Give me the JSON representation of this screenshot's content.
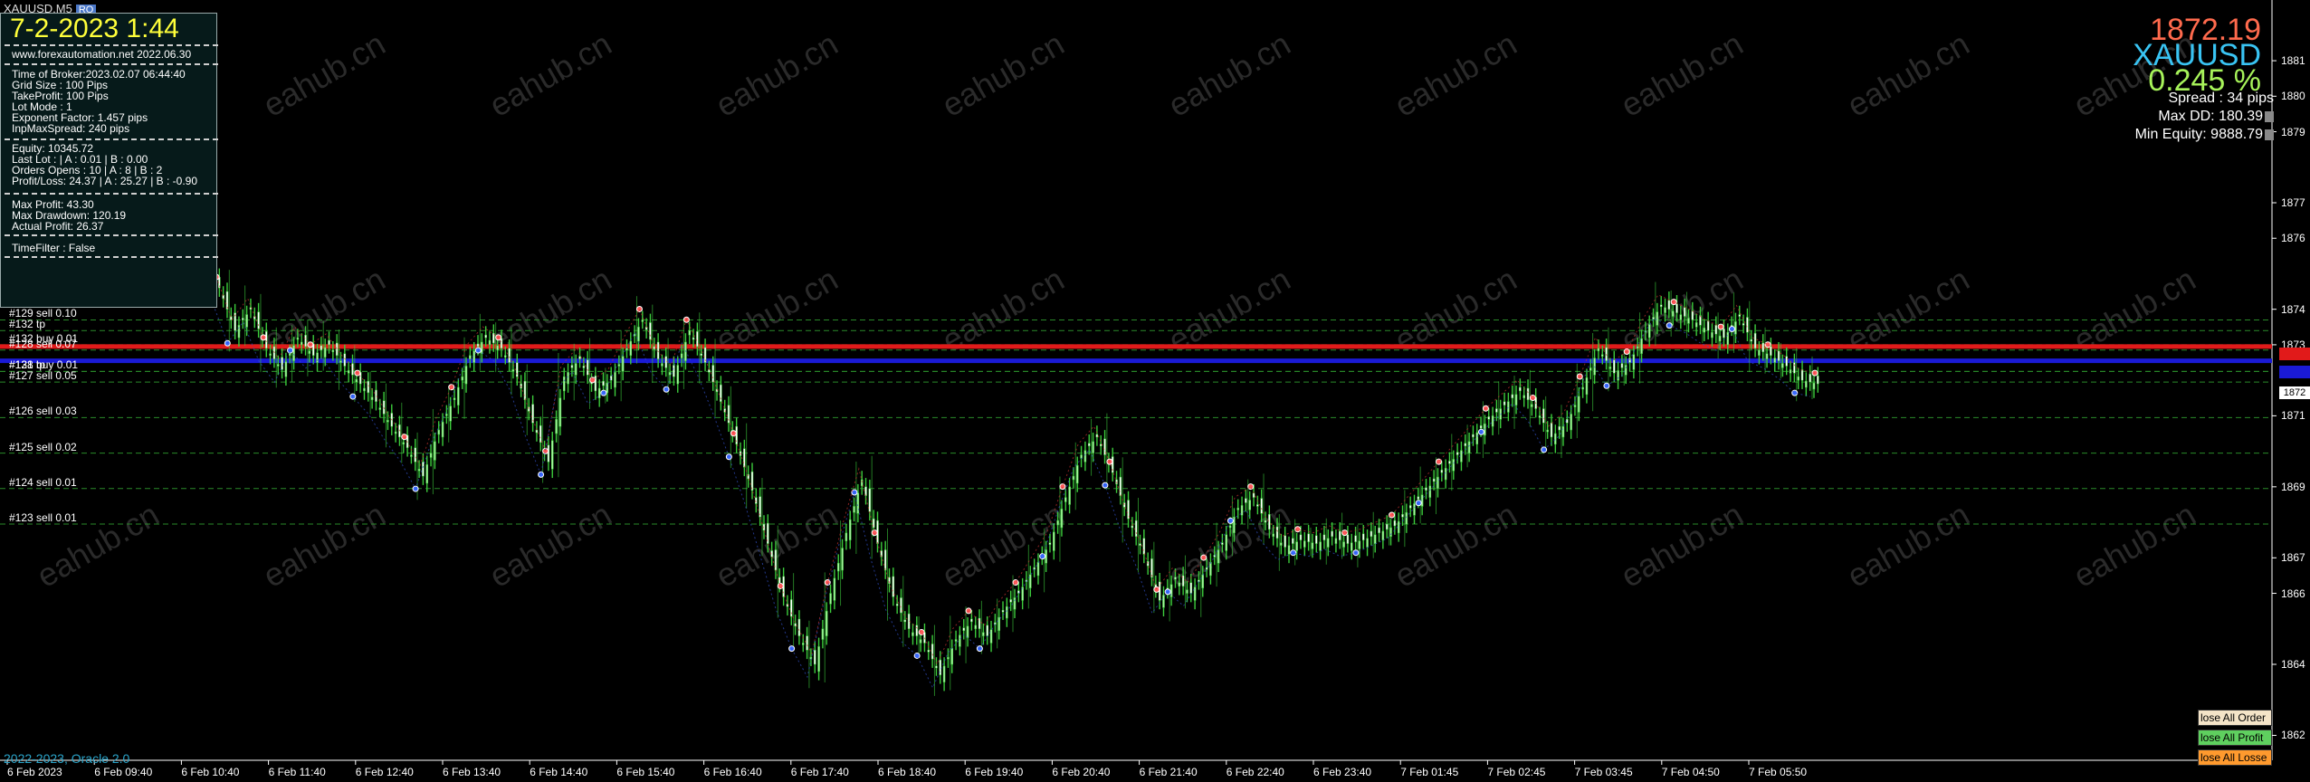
{
  "window": {
    "symbol_tf": "XAUUSD,M5",
    "badge": "RO"
  },
  "panel": {
    "datetime": "7-2-2023 1:44",
    "site": "www.forexautomation.net 2022.06.30",
    "block1": [
      "Time of Broker:2023.02.07 06:44:40",
      "Grid Size : 100 Pips",
      "TakeProfit: 100 Pips",
      "Lot Mode : 1",
      "Exponent Factor: 1.457 pips",
      "InpMaxSpread: 240 pips"
    ],
    "block2": [
      "Equity:      10345.72",
      "Last Lot : | A : 0.01 | B : 0.00",
      "Orders Opens :   10  | A : 8 | B : 2",
      "Profit/Loss: 24.37 | A : 25.27 | B : -0.90"
    ],
    "block3": [
      "Max Profit: 43.30",
      "Max Drawdown: 120.19",
      "Actual Profit: 26.37"
    ],
    "block4": [
      "TimeFilter : False"
    ]
  },
  "stats": {
    "price": "1872.19",
    "symbol": "XAUUSD",
    "percent": "0.245 %",
    "spread": "Spread : 34 pips",
    "max_dd": "Max DD: 180.39",
    "min_equity": "Min Equity: 9888.79"
  },
  "levels": [
    {
      "label": "#129 sell 0.10",
      "price": 1873.9
    },
    {
      "label": "#132 tp",
      "price": 1873.6
    },
    {
      "label": "#132 buy 0.01",
      "price": 1873.2
    },
    {
      "label": "#128 sell 0.07",
      "price": 1873.05
    },
    {
      "label": "#128 tp",
      "price": 1872.45
    },
    {
      "label": "#131 buy 0.01",
      "price": 1872.45
    },
    {
      "label": "#127 sell 0.05",
      "price": 1872.15
    },
    {
      "label": "#126 sell 0.03",
      "price": 1871.15
    },
    {
      "label": "#125 sell 0.02",
      "price": 1870.15
    },
    {
      "label": "#124 sell 0.01",
      "price": 1869.15
    },
    {
      "label": "#123 sell 0.01",
      "price": 1868.15
    }
  ],
  "axis": {
    "ymin": 1861.6,
    "ymax": 1882.4,
    "yticks": [
      "1881",
      "1880",
      "1879",
      "1877",
      "1876",
      "1874",
      "1873",
      "1871",
      "1869",
      "1867",
      "1866",
      "1864",
      "1862"
    ],
    "current_tag": "1872",
    "xticks": [
      "6 Feb 2023",
      "6 Feb 09:40",
      "6 Feb 10:40",
      "6 Feb 11:40",
      "6 Feb 12:40",
      "6 Feb 13:40",
      "6 Feb 14:40",
      "6 Feb 15:40",
      "6 Feb 16:40",
      "6 Feb 17:40",
      "6 Feb 18:40",
      "6 Feb 19:40",
      "6 Feb 20:40",
      "6 Feb 21:40",
      "6 Feb 22:40",
      "6 Feb 23:40",
      "7 Feb 01:45",
      "7 Feb 02:45",
      "7 Feb 03:45",
      "7 Feb 04:50",
      "7 Feb 05:50"
    ]
  },
  "series_close": [
    1874.8,
    1873.6,
    1874.2,
    1873.1,
    1872.5,
    1873.4,
    1872.9,
    1873.2,
    1872.6,
    1872.1,
    1871.6,
    1870.9,
    1870.3,
    1869.5,
    1870.8,
    1871.7,
    1872.9,
    1873.4,
    1873.1,
    1872.3,
    1871.0,
    1869.9,
    1872.3,
    1872.8,
    1871.9,
    1872.2,
    1873.1,
    1873.9,
    1872.8,
    1872.3,
    1873.6,
    1872.7,
    1871.6,
    1870.4,
    1869.1,
    1867.6,
    1866.1,
    1865.0,
    1864.2,
    1866.2,
    1867.9,
    1869.4,
    1867.6,
    1866.1,
    1865.2,
    1864.8,
    1863.9,
    1864.9,
    1865.4,
    1865.0,
    1865.7,
    1866.2,
    1866.9,
    1867.6,
    1868.9,
    1870.1,
    1870.6,
    1869.6,
    1868.3,
    1867.3,
    1866.0,
    1866.6,
    1866.2,
    1866.9,
    1867.6,
    1868.6,
    1868.9,
    1868.0,
    1867.5,
    1867.7,
    1867.6,
    1867.8,
    1867.6,
    1867.7,
    1867.9,
    1868.1,
    1868.6,
    1869.1,
    1869.6,
    1870.1,
    1870.6,
    1871.1,
    1871.5,
    1871.9,
    1871.4,
    1870.6,
    1871.0,
    1872.0,
    1873.1,
    1872.4,
    1872.7,
    1873.6,
    1874.3,
    1874.1,
    1873.9,
    1873.6,
    1873.4,
    1874.0,
    1873.1,
    1872.9,
    1872.6,
    1872.2,
    1872.1
  ],
  "labels_misc": {
    "copyright": "2022-2023, Oracle 2.0",
    "watermark": "eahub.cn"
  },
  "buttons": {
    "close_all": "lose All Order",
    "close_profit": "lose All Profit",
    "close_loss": "lose All Losse"
  },
  "colors": {
    "bull": "#a8f5a0",
    "bear": "#ffffff",
    "wick": "#3ccc3c",
    "red_line": "#e11a1a",
    "blue_line": "#1a1ad6",
    "grid_green": "#2a8a2a"
  }
}
